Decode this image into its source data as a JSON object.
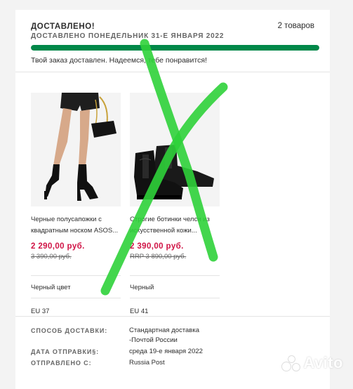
{
  "order": {
    "status_title": "ДОСТАВЛЕНО!",
    "items_count": "2 товаров",
    "status_subtitle": "ДОСТАВЛЕНО ПОНЕДЕЛЬНИК 31-Е ЯНВАРЯ 2022",
    "progress_percent": 100,
    "progress_color": "#018849",
    "message": "Твой заказ доставлен. Надеемся, тебе понравится!"
  },
  "products": [
    {
      "name": "Черные полусапожки с квадратным носком ASOS...",
      "price": "2 290,00 руб.",
      "old_price": "3 390,00 руб.",
      "color": "Черный цвет",
      "size": "EU 37"
    },
    {
      "name": "Строгие ботинки челси из искусственной кожи...",
      "price": "2 390,00 руб.",
      "old_price": "RRP 3 890,00 руб.",
      "color": "Черный",
      "size": "EU 41"
    }
  ],
  "delivery": {
    "method_label": "СПОСОБ ДОСТАВКИ:",
    "method_value_line1": "Стандартная доставка",
    "method_value_line2": "-Почтой России",
    "date_label": "ДАТА ОТПРАВКИ§:",
    "date_value": "среда 19-е января 2022",
    "sent_label": "ОТПРАВЛЕНО С:",
    "sent_value": "Russia Post"
  },
  "colors": {
    "accent_green": "#018849",
    "price_red": "#d01345",
    "cross_mark": "#2fd13a"
  },
  "watermark": {
    "text": "Avito"
  }
}
